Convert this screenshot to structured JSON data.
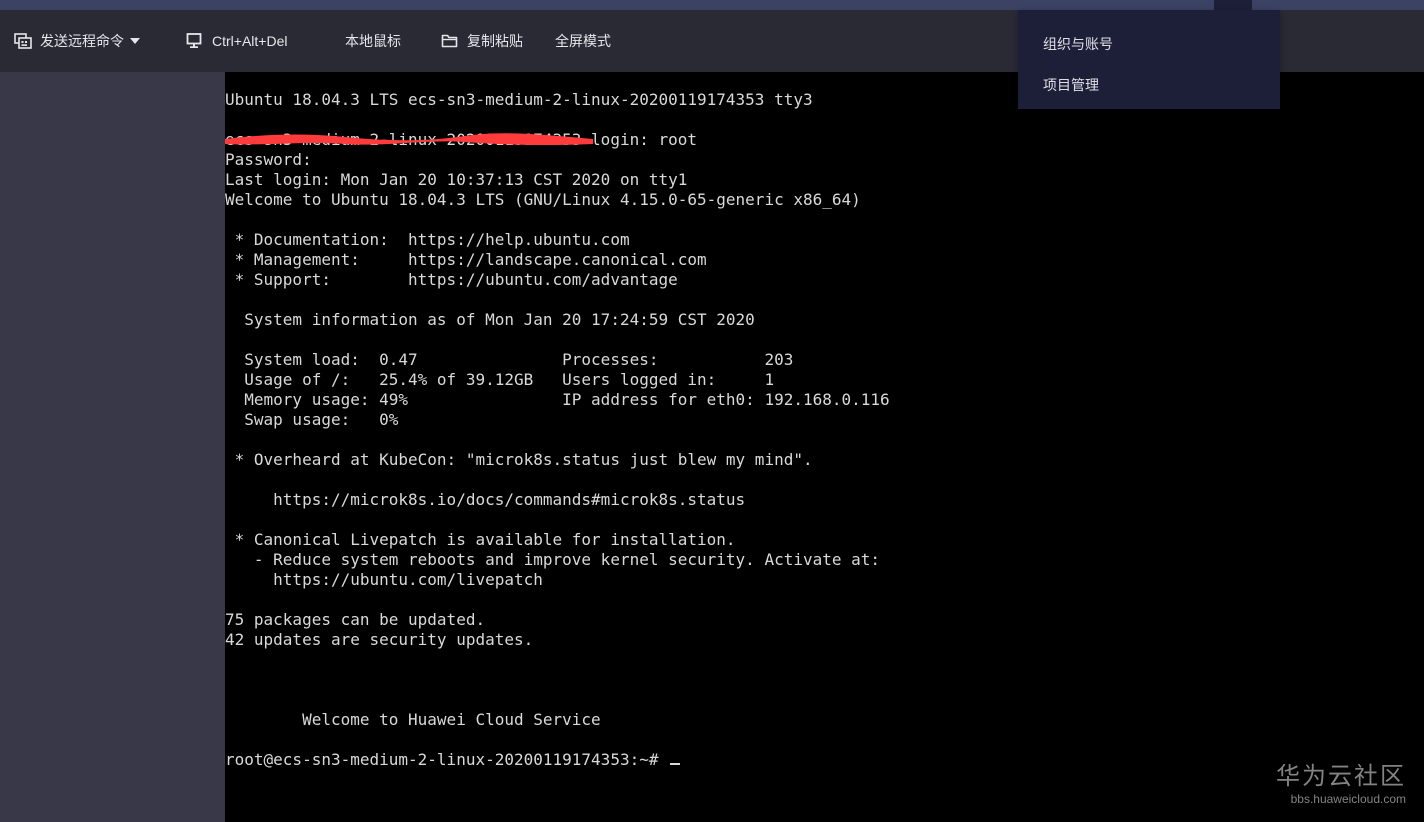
{
  "toolbar": {
    "send_remote_cmd": "发送远程命令",
    "ctrl_alt_del": "Ctrl+Alt+Del",
    "local_mouse": "本地鼠标",
    "copy_paste": "复制粘贴",
    "fullscreen": "全屏模式"
  },
  "dropdown": {
    "items": [
      "组织与账号",
      "项目管理"
    ]
  },
  "terminal": {
    "lines": [
      "Ubuntu 18.04.3 LTS ecs-sn3-medium-2-linux-20200119174353 tty3",
      "",
      "ecs-sn3-medium-2-linux-20200119174353 login: root",
      "Password:",
      "Last login: Mon Jan 20 10:37:13 CST 2020 on tty1",
      "Welcome to Ubuntu 18.04.3 LTS (GNU/Linux 4.15.0-65-generic x86_64)",
      "",
      " * Documentation:  https://help.ubuntu.com",
      " * Management:     https://landscape.canonical.com",
      " * Support:        https://ubuntu.com/advantage",
      "",
      "  System information as of Mon Jan 20 17:24:59 CST 2020",
      "",
      "  System load:  0.47               Processes:           203",
      "  Usage of /:   25.4% of 39.12GB   Users logged in:     1",
      "  Memory usage: 49%                IP address for eth0: 192.168.0.116",
      "  Swap usage:   0%",
      "",
      " * Overheard at KubeCon: \"microk8s.status just blew my mind\".",
      "",
      "     https://microk8s.io/docs/commands#microk8s.status",
      "",
      " * Canonical Livepatch is available for installation.",
      "   - Reduce system reboots and improve kernel security. Activate at:",
      "     https://ubuntu.com/livepatch",
      "",
      "75 packages can be updated.",
      "42 updates are security updates.",
      "",
      "",
      "",
      "        Welcome to Huawei Cloud Service",
      "",
      "root@ecs-sn3-medium-2-linux-20200119174353:~# "
    ]
  },
  "watermark": {
    "title": "华为云社区",
    "url": "bbs.huaweicloud.com"
  },
  "colors": {
    "toolbar_bg": "#2a2a35",
    "top_strip": "#3b4263",
    "sidebar_bg": "#383848",
    "terminal_bg": "#000000",
    "terminal_fg": "#d9d9d9",
    "dropdown_bg": "#1d1f38",
    "redaction": "#ff3b3b"
  },
  "icons": {
    "send_remote_cmd": "keyboard-icon",
    "ctrl_alt_del": "monitor-icon",
    "copy_paste": "folder-icon",
    "caret": "caret-down-icon"
  }
}
